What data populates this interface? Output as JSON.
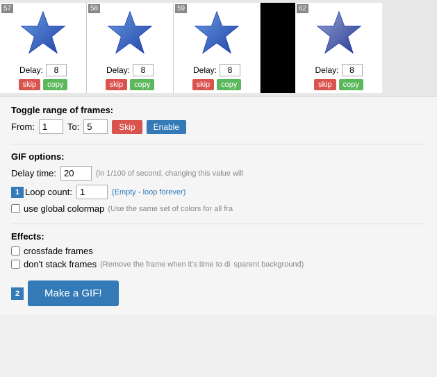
{
  "frames": [
    {
      "number": "57",
      "delay": "8",
      "skip_label": "skip",
      "copy_label": "copy"
    },
    {
      "number": "58",
      "delay": "8",
      "skip_label": "skip",
      "copy_label": "copy"
    },
    {
      "number": "59",
      "delay": "8",
      "skip_label": "skip",
      "copy_label": "copy"
    },
    {
      "number": "62",
      "delay": "8",
      "skip_label": "skip",
      "copy_label": "copy"
    }
  ],
  "toggle_range": {
    "label": "Toggle range of frames:",
    "from_label": "From:",
    "from_value": "1",
    "to_label": "To:",
    "to_value": "5",
    "skip_label": "Skip",
    "enable_label": "Enable"
  },
  "gif_options": {
    "label": "GIF options:",
    "delay_label": "Delay time:",
    "delay_value": "20",
    "delay_hint": "(in 1/100 of second, changing this value will",
    "loop_label": "Loop count:",
    "loop_value": "1",
    "loop_hint": "(Empty - loop forever)",
    "loop_badge": "1",
    "colormap_label": "use global colormap",
    "colormap_hint": "(Use the same set of colors for all fra"
  },
  "effects": {
    "label": "Effects:",
    "crossfade_label": "crossfade frames",
    "stack_label": "don't stack frames",
    "stack_hint": "(Remove the frame when it's time to di",
    "stack_hint2": "sparent background)"
  },
  "make_gif": {
    "badge": "2",
    "button_label": "Make a GIF!"
  }
}
